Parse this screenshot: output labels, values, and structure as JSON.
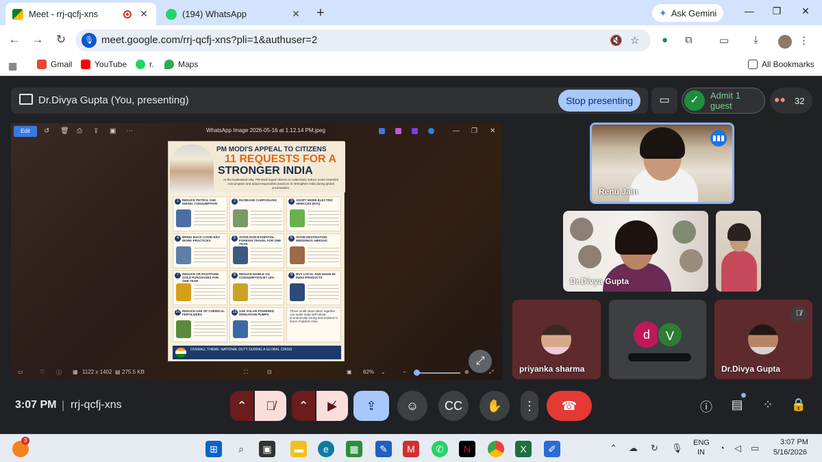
{
  "browser": {
    "tabs": [
      {
        "title": "Meet - rrj-qcfj-xns",
        "active": true,
        "favicon": "google-meet-icon"
      },
      {
        "title": "(194) WhatsApp",
        "active": false,
        "favicon": "whatsapp-icon"
      }
    ],
    "ask_gemini": "Ask Gemini",
    "url": "meet.google.com/rrj-qcfj-xns?pli=1&authuser=2",
    "bookmarks": [
      {
        "label": "Gmail",
        "icon": "gmail-icon",
        "color": "#ea4335"
      },
      {
        "label": "YouTube",
        "icon": "youtube-icon",
        "color": "#ff0000"
      },
      {
        "label": "r.",
        "icon": "whatsapp-icon",
        "color": "#25d366"
      },
      {
        "label": "Maps",
        "icon": "maps-icon",
        "color": "#34a853"
      }
    ],
    "all_bookmarks": "All Bookmarks"
  },
  "meet": {
    "presenting_banner": "Dr.Divya Gupta (You, presenting)",
    "stop_presenting": "Stop presenting",
    "admit_guest": "Admit 1 guest",
    "participant_count": "32",
    "time": "3:07 PM",
    "separator": "|",
    "meeting_code": "rrj-qcfj-xns",
    "tiles": {
      "renu": "Renu Jain",
      "divya": "Dr.Divya Gupta",
      "priyanka": "priyanka sharma",
      "letter_d": "d",
      "letter_v": "V",
      "divya2": "Dr.Divya Gupta"
    },
    "accent_colors": {
      "end_call": "#e53935",
      "stop_btn": "#a8c7fa",
      "active_tile": "#8ab4f8",
      "admit": "#81c995"
    }
  },
  "shared_screen": {
    "viewer_title": "WhatsApp Image 2026-05-16 at 1.12.14 PM.jpeg",
    "edit_label": "Edit",
    "dimensions": "1122 x 1402",
    "file_size": "275.5 KB",
    "zoom": "62%",
    "poster": {
      "heading": "PM MODI'S APPEAL TO CITIZENS",
      "big_line1": "11 REQUESTS FOR A",
      "big_line2": "STRONGER INDIA",
      "subtitle": "At the Hyderabad rally, PM Modi urged citizens to collectively reduce some essential consumption and adopt responsible practices to strengthen India during global uncertainties.",
      "items": [
        {
          "n": "1",
          "title": "REDUCE PETROL AND DIESEL CONSUMPTION",
          "color": "#4a6fa5"
        },
        {
          "n": "2",
          "title": "INCREASE CARPOOLING",
          "color": "#7a9a6a"
        },
        {
          "n": "3",
          "title": "ADOPT MORE ELECTRIC VEHICLES (EVs)",
          "color": "#6ab04c"
        },
        {
          "n": "4",
          "title": "BRING BACK COVID-ERA WORK PRACTICES",
          "color": "#5d7fa8"
        },
        {
          "n": "5",
          "title": "AVOID NON-ESSENTIAL FOREIGN TRAVEL FOR ONE YEAR",
          "color": "#3d5a80"
        },
        {
          "n": "6",
          "title": "AVOID DESTINATION WEDDINGS ABROAD",
          "color": "#9a6a4a"
        },
        {
          "n": "7",
          "title": "REDUCE OR POSTPONE GOLD PURCHASES FOR ONE YEAR",
          "color": "#d4a017"
        },
        {
          "n": "8",
          "title": "REDUCE EDIBLE OIL CONSUMPTION BY 10%",
          "color": "#c9a227"
        },
        {
          "n": "9",
          "title": "BUY LOCAL AND MADE-IN-INDIA PRODUCTS",
          "color": "#2e4a7a"
        },
        {
          "n": "10",
          "title": "REDUCE USE OF CHEMICAL FERTILIZERS",
          "color": "#5a8a3a"
        },
        {
          "n": "11",
          "title": "USE SOLAR-POWERED IRRIGATION PUMPS",
          "color": "#3a6aa5"
        },
        {
          "n": "",
          "title": "These small steps taken together can make India self-reliant, economically strong and resilient in times of global crisis.",
          "color": "#e8d9b8"
        }
      ],
      "footer": "OVERALL THEME: NATIONAL DUTY DURING A GLOBAL CRISIS"
    }
  },
  "taskbar": {
    "notification_count": "3",
    "lang": "ENG",
    "region": "IN",
    "time": "3:07 PM",
    "date": "5/16/2026"
  }
}
